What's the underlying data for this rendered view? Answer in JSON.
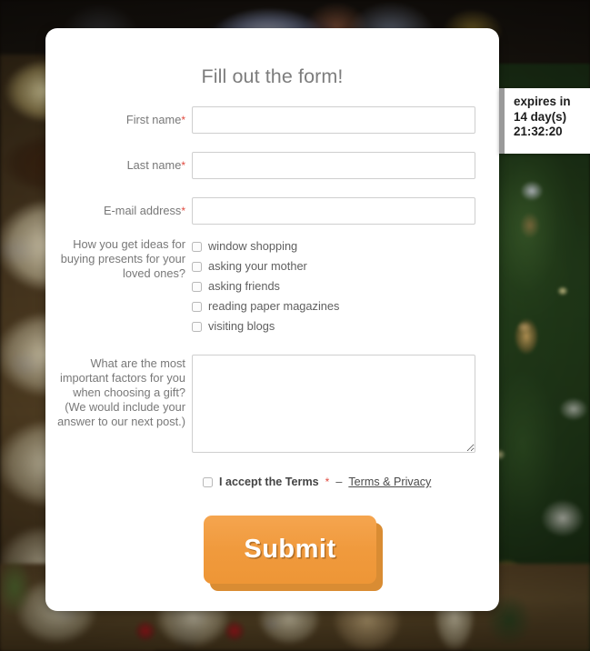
{
  "background": {
    "description": "blurred photograph of a christmas gift shop: ceramic blue-and-beige pottery on the left and bottom shelves, a lit christmas tree with ornaments on the right, an antique clock face at the top"
  },
  "form": {
    "title": "Fill out the form!",
    "required_marker": "*",
    "fields": [
      {
        "id": "first-name",
        "label": "First name",
        "required": true,
        "type": "text",
        "value": "",
        "placeholder": ""
      },
      {
        "id": "last-name",
        "label": "Last name",
        "required": true,
        "type": "text",
        "value": "",
        "placeholder": ""
      },
      {
        "id": "email-address",
        "label": "E-mail address",
        "required": true,
        "type": "text",
        "value": "",
        "placeholder": ""
      }
    ],
    "checkbox_group": {
      "label": "How you get ideas for buying presents for your loved ones?",
      "options": [
        {
          "label": "window shopping",
          "checked": false
        },
        {
          "label": "asking your mother",
          "checked": false
        },
        {
          "label": "asking friends",
          "checked": false
        },
        {
          "label": "reading paper magazines",
          "checked": false
        },
        {
          "label": "visiting blogs",
          "checked": false
        }
      ]
    },
    "textarea": {
      "label": "What are the most important factors for you when choosing a gift? (We would include your answer to our next post.)",
      "value": "",
      "placeholder": ""
    },
    "terms": {
      "text": "I accept the Terms",
      "required": true,
      "separator": "–",
      "link_label": "Terms & Privacy",
      "checked": false
    },
    "submit_label": "Submit",
    "submit_color": "#f0993b",
    "submit_shadow_color": "#d98c33",
    "title_color": "#7d7d7d",
    "label_color": "#787878",
    "required_color": "#e04a3f"
  },
  "expires_widget": {
    "line1": "expires in",
    "line2": "14 day(s)",
    "line3": "21:32:20",
    "accent_color": "#9a9a9a",
    "text_color": "#1c1c1c"
  }
}
